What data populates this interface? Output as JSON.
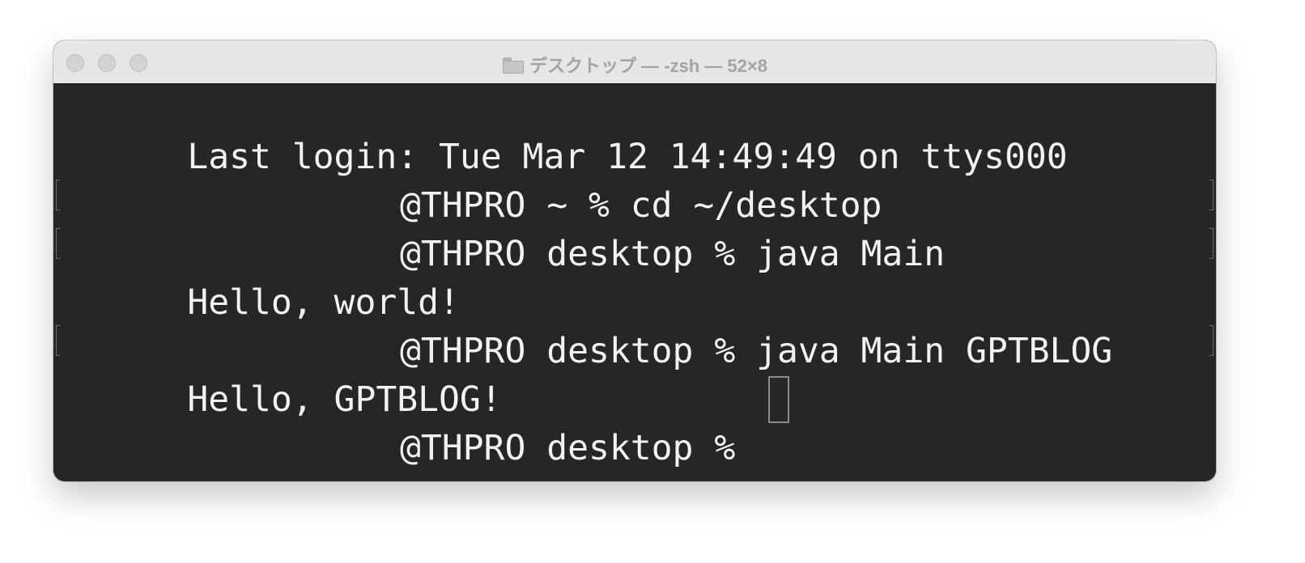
{
  "window": {
    "title": "デスクトップ — -zsh — 52×8",
    "title_icon": "folder-icon",
    "traffic_lights": [
      "close-button",
      "minimize-button",
      "zoom-button"
    ]
  },
  "terminal": {
    "background": "#262626",
    "foreground": "#f2f2f2",
    "lines": [
      "Last login: Tue Mar 12 14:49:49 on ttys000",
      "@THPRO ~ % cd ~/desktop",
      "@THPRO desktop % java Main",
      "Hello, world!",
      "@THPRO desktop % java Main GPTBLOG",
      "Hello, GPTBLOG!",
      "@THPRO desktop % "
    ]
  }
}
